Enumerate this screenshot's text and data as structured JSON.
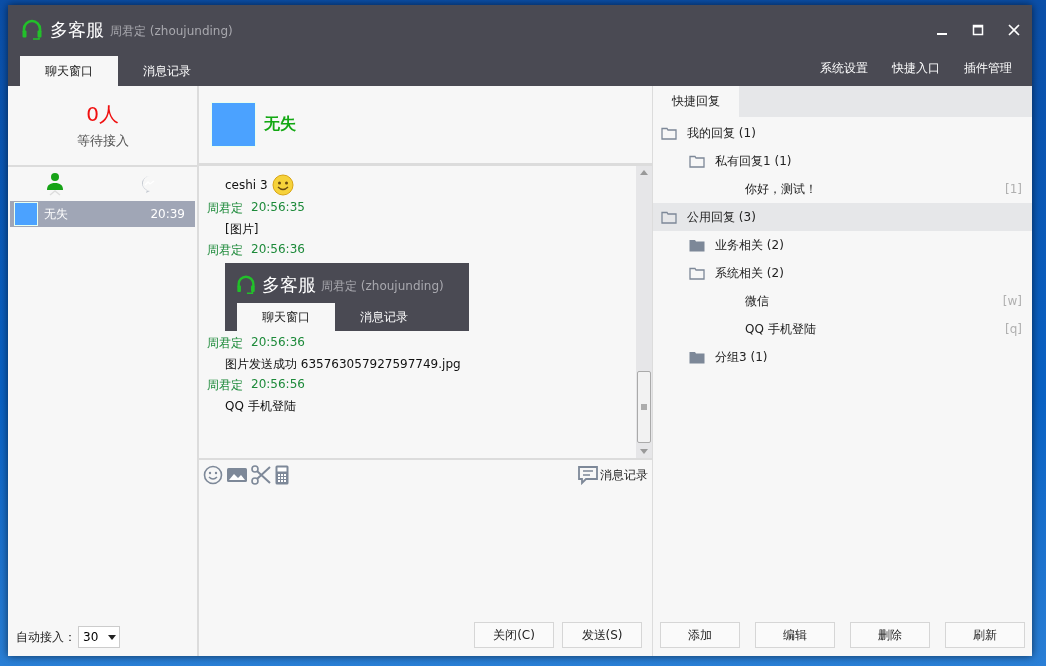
{
  "window": {
    "title": "多客服",
    "user": "周君定 (zhoujunding)"
  },
  "tabs": [
    {
      "label": "聊天窗口",
      "selected": true
    },
    {
      "label": "消息记录",
      "selected": false
    }
  ],
  "top_links": [
    "系统设置",
    "快捷入口",
    "插件管理"
  ],
  "waiting": {
    "count": "0人",
    "label": "等待接入"
  },
  "list_tabs": [
    {
      "kind": "contacts",
      "selected": true
    },
    {
      "kind": "messages",
      "selected": false
    }
  ],
  "contacts": [
    {
      "name": "无失",
      "time": "20:39",
      "selected": true
    }
  ],
  "auto_accept": {
    "label": "自动接入：",
    "value": "30"
  },
  "chat": {
    "name": "无失",
    "messages": [
      {
        "kind": "text",
        "text": "ceshi 3",
        "emoji": true
      },
      {
        "kind": "meta",
        "sender": "周君定",
        "time": "20:56:35"
      },
      {
        "kind": "text",
        "text": "[图片]",
        "emoji": false
      },
      {
        "kind": "meta",
        "sender": "周君定",
        "time": "20:56:36"
      },
      {
        "kind": "image",
        "title": "多客服",
        "user": "周君定 (zhoujunding)",
        "tabs": [
          {
            "label": "聊天窗口",
            "selected": true
          },
          {
            "label": "消息记录",
            "selected": false
          }
        ]
      },
      {
        "kind": "meta",
        "sender": "周君定",
        "time": "20:56:36"
      },
      {
        "kind": "text",
        "text": "图片发送成功 635763057927597749.jpg",
        "emoji": false
      },
      {
        "kind": "meta",
        "sender": "周君定",
        "time": "20:56:56"
      },
      {
        "kind": "text",
        "text": "QQ 手机登陆",
        "emoji": false
      }
    ],
    "history_link": "消息记录",
    "buttons": [
      "关闭(C)",
      "发送(S)"
    ]
  },
  "quick_reply": {
    "tab": "快捷回复",
    "tree": [
      {
        "kind": "folder",
        "label": "我的回复 (1)",
        "expanded": true,
        "selected": false,
        "children": [
          {
            "kind": "folder",
            "label": "私有回复1 (1)",
            "expanded": true,
            "selected": false,
            "children": [
              {
                "kind": "reply",
                "label": "你好，测试！",
                "shortcut": "[1]",
                "selected": false
              }
            ]
          }
        ]
      },
      {
        "kind": "folder",
        "label": "公用回复 (3)",
        "expanded": true,
        "selected": true,
        "children": [
          {
            "kind": "folder",
            "label": "业务相关 (2)",
            "expanded": false,
            "selected": false
          },
          {
            "kind": "folder",
            "label": "系统相关 (2)",
            "expanded": true,
            "selected": false,
            "children": [
              {
                "kind": "reply",
                "label": "微信",
                "shortcut": "[w]",
                "selected": false
              },
              {
                "kind": "reply",
                "label": "QQ 手机登陆",
                "shortcut": "[q]",
                "selected": false
              }
            ]
          },
          {
            "kind": "folder",
            "label": "分组3 (1)",
            "expanded": false,
            "selected": false
          }
        ]
      }
    ],
    "buttons": [
      "添加",
      "编辑",
      "删除",
      "刷新"
    ]
  }
}
